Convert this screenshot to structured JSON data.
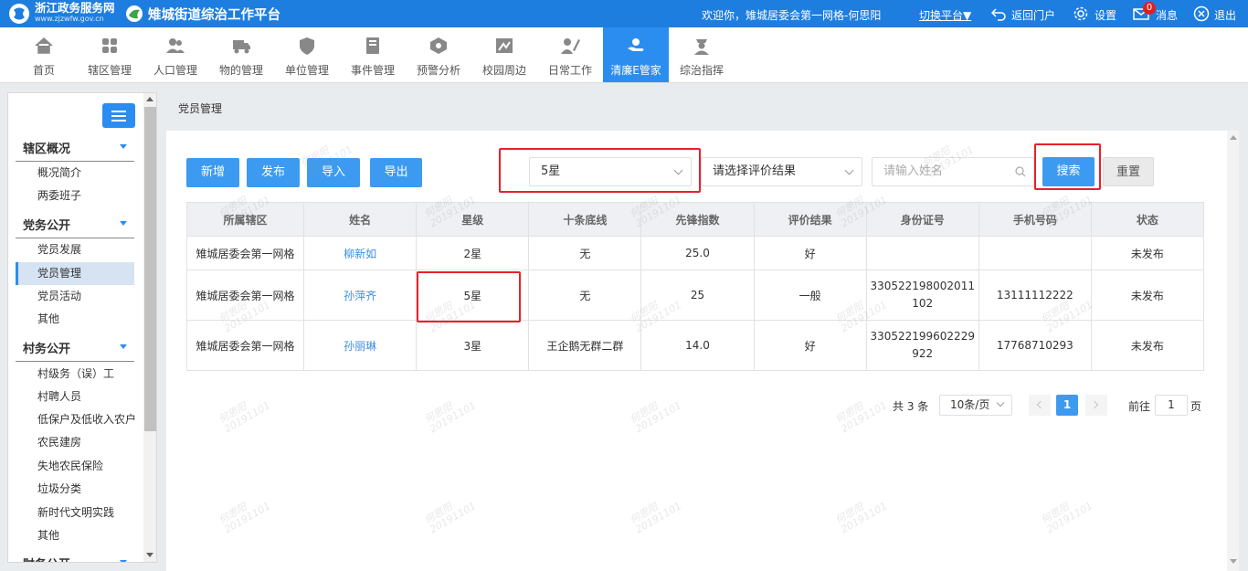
{
  "header": {
    "logo_text": "浙江政务服务网",
    "logo_sub": "www.zjzwfw.gov.cn",
    "platform_title": "雉城街道综治工作平台",
    "welcome": "欢迎你，雉城居委会第一网格-何思阳",
    "switch_platform": "切换平台▼",
    "back_portal": "返回门户",
    "settings": "设置",
    "messages": "消息",
    "message_count": "0",
    "logout": "退出"
  },
  "nav": [
    {
      "label": "首页",
      "icon": "home-icon"
    },
    {
      "label": "辖区管理",
      "icon": "grid-icon"
    },
    {
      "label": "人口管理",
      "icon": "people-icon"
    },
    {
      "label": "物的管理",
      "icon": "truck-icon"
    },
    {
      "label": "单位管理",
      "icon": "shield-icon"
    },
    {
      "label": "事件管理",
      "icon": "book-icon"
    },
    {
      "label": "预警分析",
      "icon": "warning-icon"
    },
    {
      "label": "校园周边",
      "icon": "campus-icon"
    },
    {
      "label": "日常工作",
      "icon": "pen-icon"
    },
    {
      "label": "清廉E管家",
      "icon": "hand-icon",
      "active": true
    },
    {
      "label": "综治指挥",
      "icon": "officer-icon"
    }
  ],
  "sidebar": {
    "sections": [
      {
        "title": "辖区概况",
        "items": [
          "概况简介",
          "两委班子"
        ]
      },
      {
        "title": "党务公开",
        "items": [
          "党员发展",
          "党员管理",
          "党员活动",
          "其他"
        ]
      },
      {
        "title": "村务公开",
        "items": [
          "村级务（误）工",
          "村聘人员",
          "低保户及低收入农户",
          "农民建房",
          "失地农民保险",
          "垃圾分类",
          "新时代文明实践",
          "其他"
        ]
      },
      {
        "title": "财务公开",
        "items": []
      }
    ],
    "active_item": "党员管理"
  },
  "breadcrumb": "党员管理",
  "toolbar": {
    "add": "新增",
    "publish": "发布",
    "import": "导入",
    "export": "导出",
    "star_select": "5星",
    "result_select": "请选择评价结果",
    "name_placeholder": "请输入姓名",
    "search": "搜索",
    "reset": "重置"
  },
  "table": {
    "columns": [
      "所属辖区",
      "姓名",
      "星级",
      "十条底线",
      "先锋指数",
      "评价结果",
      "身份证号",
      "手机号码",
      "状态"
    ],
    "rows": [
      [
        "雉城居委会第一网格",
        "柳新如",
        "2星",
        "无",
        "25.0",
        "好",
        "",
        "",
        "未发布"
      ],
      [
        "雉城居委会第一网格",
        "孙萍齐",
        "5星",
        "无",
        "25",
        "一般",
        "330522198002011\n102",
        "13111112222",
        "未发布"
      ],
      [
        "雉城居委会第一网格",
        "孙丽琳",
        "3星",
        "王企鹅无群二群",
        "14.0",
        "好",
        "330522199602229\n922",
        "17768710293",
        "未发布"
      ]
    ]
  },
  "pagination": {
    "total": "共 3 条",
    "page_size": "10条/页",
    "current": "1",
    "goto_label": "前往",
    "goto_value": "1",
    "page_suffix": "页"
  },
  "watermark": "何思阳\n20191101",
  "colors": {
    "topbar": "#1e7ee0",
    "accent": "#3c9bf0",
    "highlight_box": "#e8212a",
    "link": "#3c8de0"
  }
}
